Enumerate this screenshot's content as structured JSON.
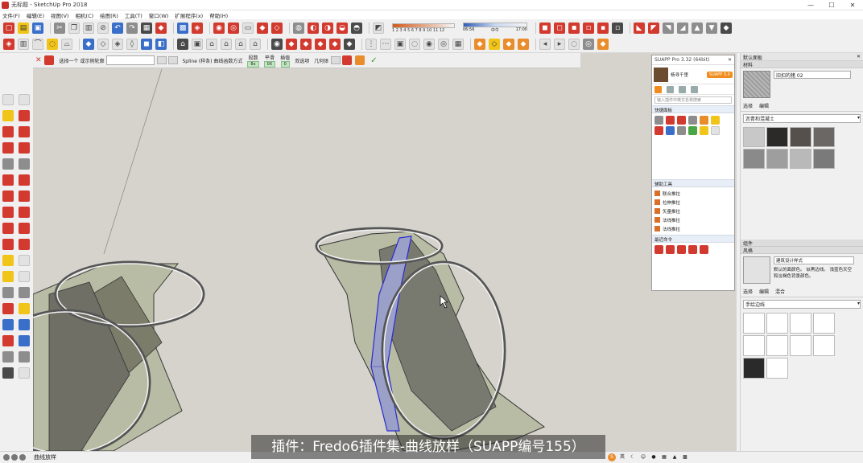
{
  "window": {
    "title": "无标题 - SketchUp Pro 2018",
    "controls": {
      "minimize": "—",
      "maximize": "☐",
      "close": "✕"
    }
  },
  "menu": [
    "文件(F)",
    "编辑(E)",
    "视图(V)",
    "相机(C)",
    "绘图(R)",
    "工具(T)",
    "窗口(W)",
    "扩展程序(x)",
    "帮助(H)"
  ],
  "shadow": {
    "months": "1 2 3 4 5 6 7 8 9 10 11 12",
    "time_start": "06:56",
    "time_mid": "中午",
    "time_end": "17:00"
  },
  "curviloft": {
    "prompt": "选择一个 或示例轮廓",
    "spline_label": "Spline (样条) 曲线函数方式",
    "groups": [
      {
        "label": "段数",
        "value": "8x"
      },
      {
        "label": "平滑",
        "value": "0X"
      },
      {
        "label": "插值",
        "value": "0"
      },
      {
        "label": "双选项",
        "value": ""
      },
      {
        "label": "几何体",
        "value": ""
      }
    ]
  },
  "suapp": {
    "header": "SUAPP Pro 3.32 (64bit)",
    "username": "杨寻千里",
    "badge": "SUAPP 3.X",
    "search_placeholder": "输入插件中英文名称搜索",
    "section_quick": "快捷面板",
    "section_assist": "辅助工具",
    "assist_items": [
      "联合推拉",
      "拉伸推拉",
      "矢量推拉",
      "法线推拉",
      "法线推拉"
    ],
    "section_recent": "最近命令"
  },
  "tray": {
    "title": "默认面板",
    "materials_header": "材料",
    "material_name": "旧扣的猪 02",
    "mat_tabs": [
      "选择",
      "编辑"
    ],
    "mat_category": "沥青和混凝土",
    "swatch_colors": [
      "#c8c8c8",
      "#2b2a29",
      "#55504c",
      "#6b6764",
      "#8a8a8a",
      "#9e9e9e",
      "#b9b9b9",
      "#7a7a7a"
    ],
    "components_header": "组件",
    "styles_header": "风格",
    "style_name": "建筑设计样式",
    "style_desc": "默认的面颜色。 似黑边线。 浅蓝色天空和淡褐色背景颜色。",
    "style_tabs": [
      "选择",
      "编辑",
      "混合"
    ],
    "style_category": "手绘边线"
  },
  "statusbar": {
    "text": "曲线放样",
    "ime": "英"
  },
  "caption": "插件：Fredo6插件集-曲线放样（SUAPP编号155）"
}
